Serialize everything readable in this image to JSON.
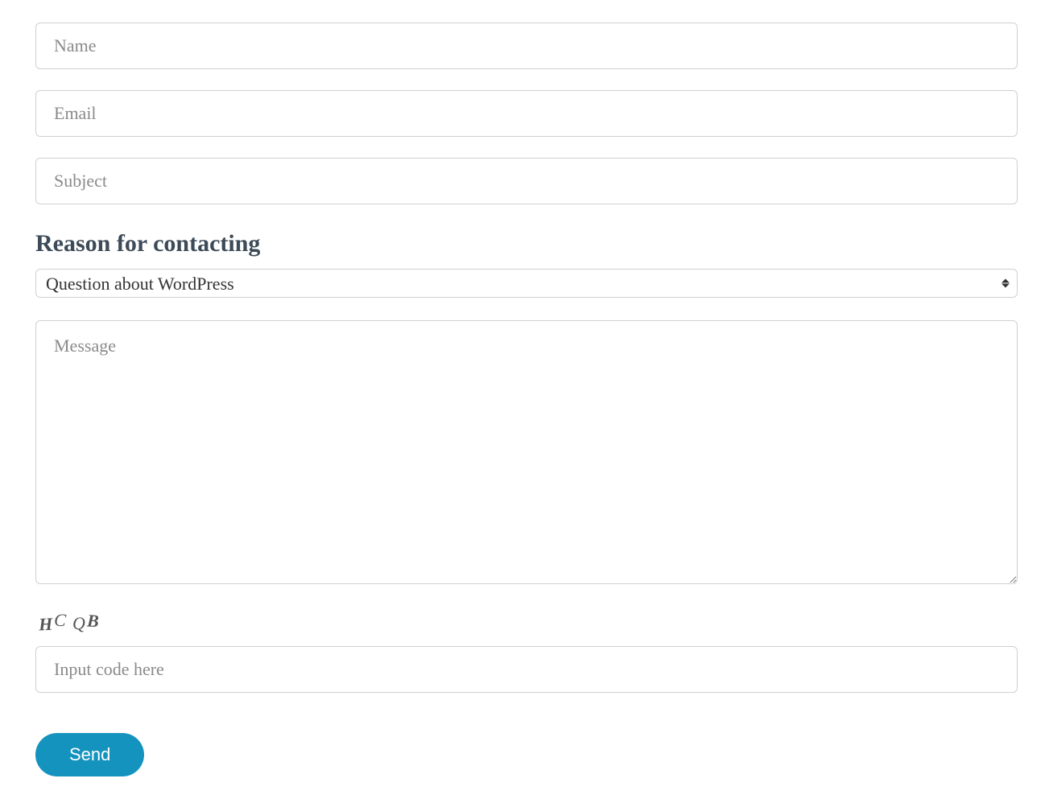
{
  "form": {
    "name": {
      "placeholder": "Name",
      "value": ""
    },
    "email": {
      "placeholder": "Email",
      "value": ""
    },
    "subject": {
      "placeholder": "Subject",
      "value": ""
    },
    "reason": {
      "label": "Reason for contacting",
      "selected": "Question about WordPress"
    },
    "message": {
      "placeholder": "Message",
      "value": ""
    },
    "captcha": {
      "code_chars": [
        "H",
        "C",
        "Q",
        "B"
      ],
      "placeholder": "Input code here",
      "value": ""
    },
    "submit": {
      "label": "Send"
    }
  },
  "colors": {
    "accent": "#1593bf",
    "border": "#d0d0d0",
    "placeholder": "#8a8a8a",
    "heading": "#3d4a57"
  }
}
